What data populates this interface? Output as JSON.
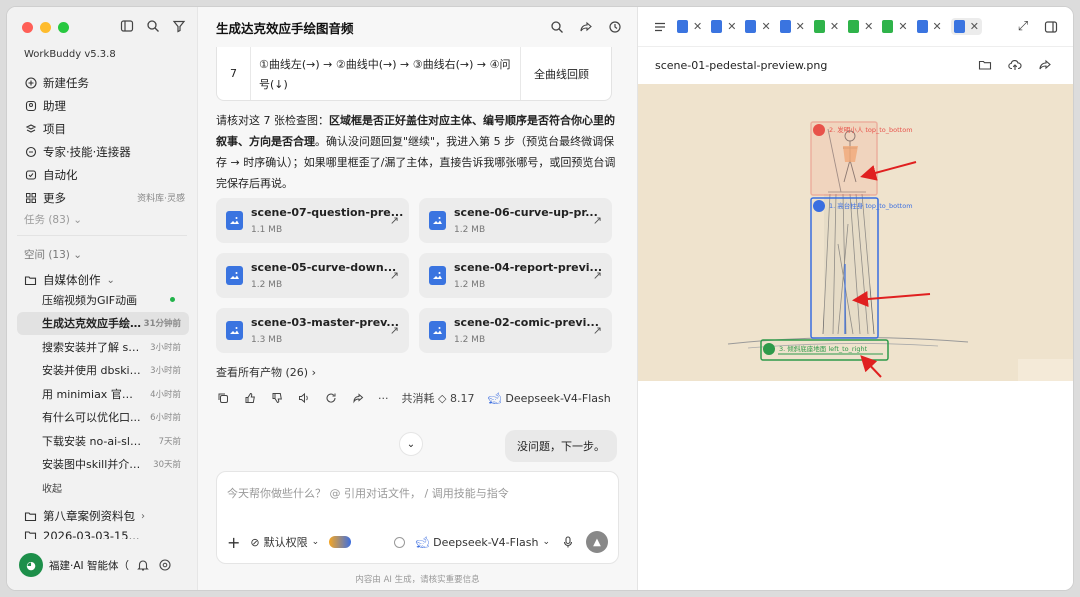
{
  "app": {
    "version": "WorkBuddy v5.3.8"
  },
  "sidebar": {
    "menu": [
      {
        "label": "新建任务",
        "icon": "plus-circle-icon"
      },
      {
        "label": "助理",
        "icon": "assistant-icon"
      },
      {
        "label": "项目",
        "icon": "project-icon"
      },
      {
        "label": "专家·技能·连接器",
        "icon": "expert-icon"
      },
      {
        "label": "自动化",
        "icon": "automation-icon"
      },
      {
        "label": "更多",
        "icon": "grid-icon",
        "extra": "资料库·灵感"
      }
    ],
    "tasks_label": "任务 (83)",
    "space_label": "空间 (13)",
    "folder_label": "自媒体创作",
    "items": [
      {
        "title": "压缩视频为GIF动画",
        "time": "",
        "status": "running"
      },
      {
        "title": "生成达克效应手绘...",
        "time": "31分钟前",
        "active": true
      },
      {
        "title": "搜索安装并了解 srt...",
        "time": "3小时前"
      },
      {
        "title": "安装并使用 dbskill ...",
        "time": "3小时前"
      },
      {
        "title": "用 minimiax 官方 A...",
        "time": "4小时前"
      },
      {
        "title": "有什么可以优化口...",
        "time": "6小时前"
      },
      {
        "title": "下载安装 no-ai-slop ...",
        "time": "7天前"
      },
      {
        "title": "安装图中skill并介绍...",
        "time": "30天前"
      }
    ],
    "collapse_label": "收起",
    "folder2_label": "第八章案例资料包",
    "folder3_label": "2026-03-03-15...",
    "user_name": "福建·AI 智能体（有事"
  },
  "chat": {
    "title": "生成达克效应手绘图音频",
    "table_row": {
      "num": "7",
      "desc": "①曲线左(→) → ②曲线中(→) → ③曲线右(→) → ④问号(↓)",
      "note": "全曲线回顾"
    },
    "paragraph_plain_1": "请核对这 7 张检查图：",
    "paragraph_bold": "区域框是否正好盖住对应主体、编号顺序是否符合你心里的叙事、方向是否合理",
    "paragraph_plain_2": "。确认没问题回复\"继续\"，我进入第 5 步（预览台最终微调保存 → 时序确认）；如果哪里框歪了/漏了主体，直接告诉我哪张哪号，或回预览台调完保存后再说。",
    "files": [
      {
        "name": "scene-07-question-pre...",
        "size": "1.1 MB"
      },
      {
        "name": "scene-06-curve-up-pr...",
        "size": "1.2 MB"
      },
      {
        "name": "scene-05-curve-down...",
        "size": "1.2 MB"
      },
      {
        "name": "scene-04-report-previ...",
        "size": "1.2 MB"
      },
      {
        "name": "scene-03-master-prev...",
        "size": "1.3 MB"
      },
      {
        "name": "scene-02-comic-previ...",
        "size": "1.2 MB"
      }
    ],
    "all_outputs": "查看所有产物 (26)",
    "cost": "共消耗 ◇ 8.17",
    "model": "Deepseek-V4-Flash",
    "user_message": "没问题，下一步。",
    "composer_placeholder": "今天帮你做些什么？ @ 引用对话文件， / 调用技能与指令",
    "permission": "默认权限",
    "composer_model": "Deepseek-V4-Flash",
    "disclaimer": "内容由 AI 生成，请核实重要信息"
  },
  "preview": {
    "tabs": [
      {
        "color": "#3a74e0"
      },
      {
        "color": "#3a74e0"
      },
      {
        "color": "#3a74e0"
      },
      {
        "color": "#3a74e0"
      },
      {
        "color": "#2fb34a"
      },
      {
        "color": "#2fb34a"
      },
      {
        "color": "#2fb34a"
      },
      {
        "color": "#3a74e0"
      },
      {
        "color": "#3a74e0",
        "active": true
      }
    ],
    "filename": "scene-01-pedestal-preview.png",
    "annotations": [
      {
        "label": "2. 发明小人  top_to_bottom",
        "color": "#e8524a"
      },
      {
        "label": "1. 高台柱身  top_to_bottom",
        "color": "#3a6ee0"
      },
      {
        "label": "3. 倾斜底座地面  left_to_right",
        "color": "#2e9a4a"
      }
    ]
  }
}
